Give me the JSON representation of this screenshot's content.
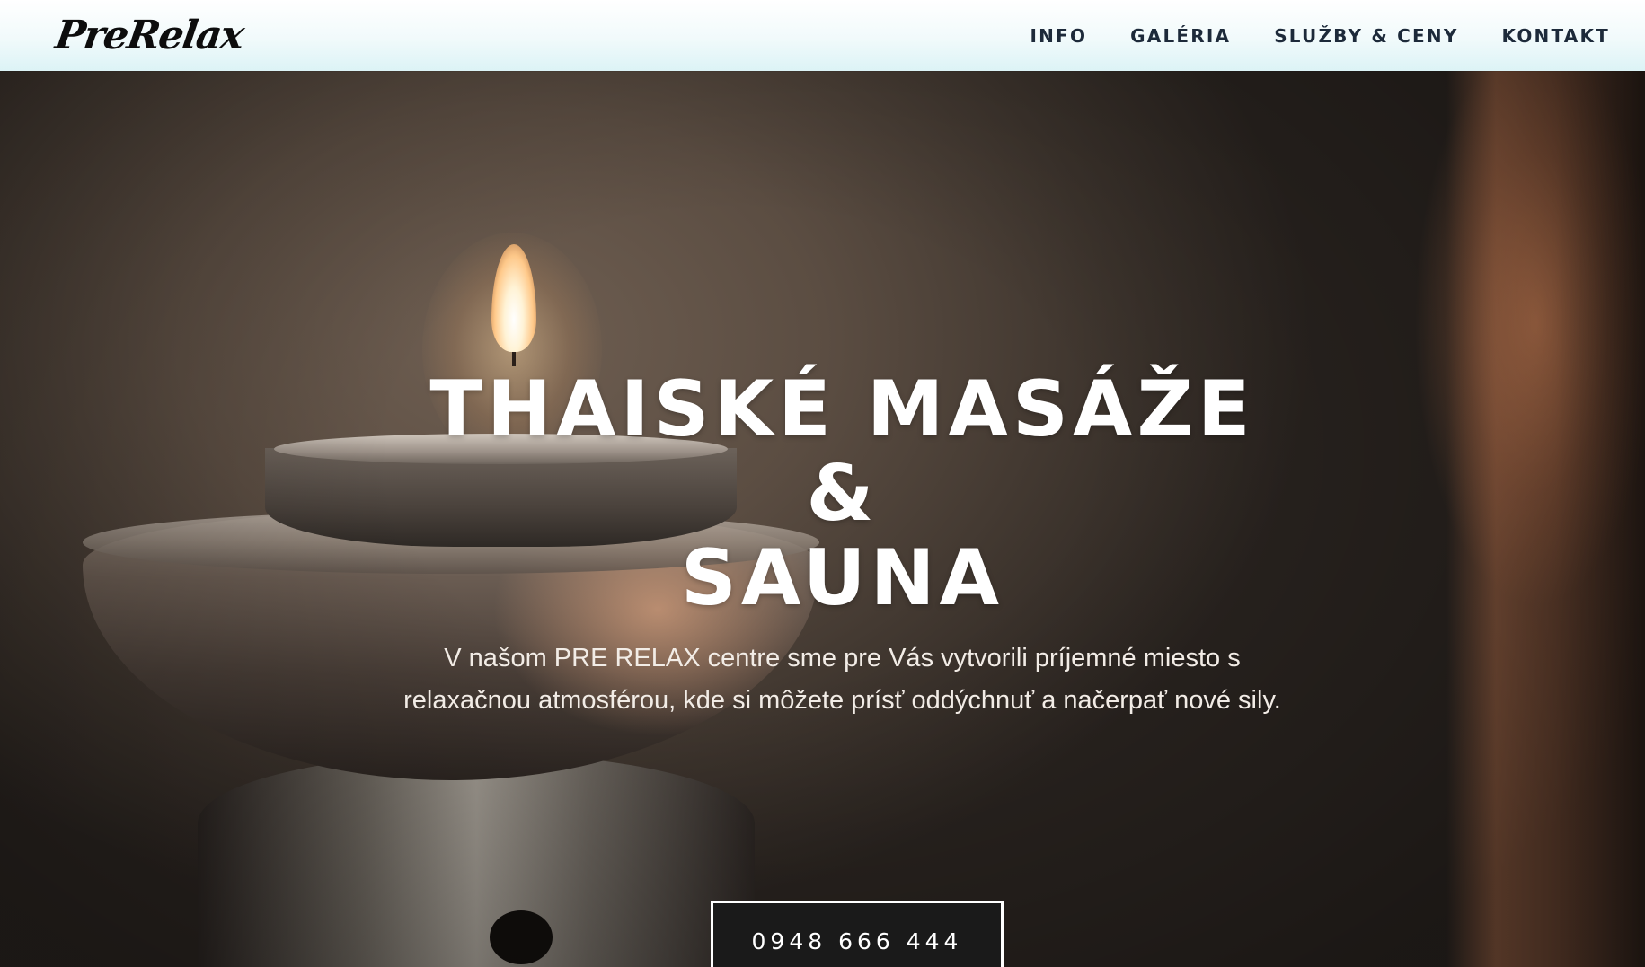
{
  "header": {
    "logo": "PreRelax",
    "nav": [
      "INFO",
      "GALÉRIA",
      "SLUŽBY & CENY",
      "KONTAKT"
    ]
  },
  "hero": {
    "title_line1": "THAISKÉ MASÁŽE",
    "title_line2": "&",
    "title_line3": "SAUNA",
    "description": "V našom PRE RELAX centre sme pre Vás vytvorili príjemné miesto s relaxačnou atmosférou, kde si môžete prísť oddýchnuť a načerpať nové sily.",
    "phone_button": "0948 666 444",
    "background_image": "candle-oil-burner-photo"
  },
  "colors": {
    "header_bg": "#e9f7f9",
    "nav_text": "#1d2a3a",
    "hero_text": "#ffffff",
    "button_bg": "#1a1a1a",
    "button_border": "#ffffff"
  }
}
